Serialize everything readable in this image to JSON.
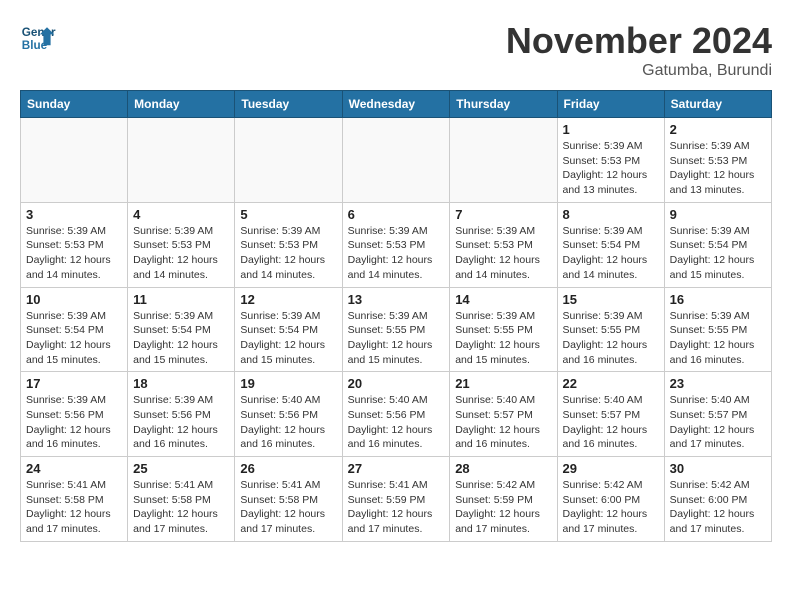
{
  "header": {
    "logo_line1": "General",
    "logo_line2": "Blue",
    "month": "November 2024",
    "location": "Gatumba, Burundi"
  },
  "weekdays": [
    "Sunday",
    "Monday",
    "Tuesday",
    "Wednesday",
    "Thursday",
    "Friday",
    "Saturday"
  ],
  "weeks": [
    [
      {
        "day": "",
        "info": ""
      },
      {
        "day": "",
        "info": ""
      },
      {
        "day": "",
        "info": ""
      },
      {
        "day": "",
        "info": ""
      },
      {
        "day": "",
        "info": ""
      },
      {
        "day": "1",
        "info": "Sunrise: 5:39 AM\nSunset: 5:53 PM\nDaylight: 12 hours\nand 13 minutes."
      },
      {
        "day": "2",
        "info": "Sunrise: 5:39 AM\nSunset: 5:53 PM\nDaylight: 12 hours\nand 13 minutes."
      }
    ],
    [
      {
        "day": "3",
        "info": "Sunrise: 5:39 AM\nSunset: 5:53 PM\nDaylight: 12 hours\nand 14 minutes."
      },
      {
        "day": "4",
        "info": "Sunrise: 5:39 AM\nSunset: 5:53 PM\nDaylight: 12 hours\nand 14 minutes."
      },
      {
        "day": "5",
        "info": "Sunrise: 5:39 AM\nSunset: 5:53 PM\nDaylight: 12 hours\nand 14 minutes."
      },
      {
        "day": "6",
        "info": "Sunrise: 5:39 AM\nSunset: 5:53 PM\nDaylight: 12 hours\nand 14 minutes."
      },
      {
        "day": "7",
        "info": "Sunrise: 5:39 AM\nSunset: 5:53 PM\nDaylight: 12 hours\nand 14 minutes."
      },
      {
        "day": "8",
        "info": "Sunrise: 5:39 AM\nSunset: 5:54 PM\nDaylight: 12 hours\nand 14 minutes."
      },
      {
        "day": "9",
        "info": "Sunrise: 5:39 AM\nSunset: 5:54 PM\nDaylight: 12 hours\nand 15 minutes."
      }
    ],
    [
      {
        "day": "10",
        "info": "Sunrise: 5:39 AM\nSunset: 5:54 PM\nDaylight: 12 hours\nand 15 minutes."
      },
      {
        "day": "11",
        "info": "Sunrise: 5:39 AM\nSunset: 5:54 PM\nDaylight: 12 hours\nand 15 minutes."
      },
      {
        "day": "12",
        "info": "Sunrise: 5:39 AM\nSunset: 5:54 PM\nDaylight: 12 hours\nand 15 minutes."
      },
      {
        "day": "13",
        "info": "Sunrise: 5:39 AM\nSunset: 5:55 PM\nDaylight: 12 hours\nand 15 minutes."
      },
      {
        "day": "14",
        "info": "Sunrise: 5:39 AM\nSunset: 5:55 PM\nDaylight: 12 hours\nand 15 minutes."
      },
      {
        "day": "15",
        "info": "Sunrise: 5:39 AM\nSunset: 5:55 PM\nDaylight: 12 hours\nand 16 minutes."
      },
      {
        "day": "16",
        "info": "Sunrise: 5:39 AM\nSunset: 5:55 PM\nDaylight: 12 hours\nand 16 minutes."
      }
    ],
    [
      {
        "day": "17",
        "info": "Sunrise: 5:39 AM\nSunset: 5:56 PM\nDaylight: 12 hours\nand 16 minutes."
      },
      {
        "day": "18",
        "info": "Sunrise: 5:39 AM\nSunset: 5:56 PM\nDaylight: 12 hours\nand 16 minutes."
      },
      {
        "day": "19",
        "info": "Sunrise: 5:40 AM\nSunset: 5:56 PM\nDaylight: 12 hours\nand 16 minutes."
      },
      {
        "day": "20",
        "info": "Sunrise: 5:40 AM\nSunset: 5:56 PM\nDaylight: 12 hours\nand 16 minutes."
      },
      {
        "day": "21",
        "info": "Sunrise: 5:40 AM\nSunset: 5:57 PM\nDaylight: 12 hours\nand 16 minutes."
      },
      {
        "day": "22",
        "info": "Sunrise: 5:40 AM\nSunset: 5:57 PM\nDaylight: 12 hours\nand 16 minutes."
      },
      {
        "day": "23",
        "info": "Sunrise: 5:40 AM\nSunset: 5:57 PM\nDaylight: 12 hours\nand 17 minutes."
      }
    ],
    [
      {
        "day": "24",
        "info": "Sunrise: 5:41 AM\nSunset: 5:58 PM\nDaylight: 12 hours\nand 17 minutes."
      },
      {
        "day": "25",
        "info": "Sunrise: 5:41 AM\nSunset: 5:58 PM\nDaylight: 12 hours\nand 17 minutes."
      },
      {
        "day": "26",
        "info": "Sunrise: 5:41 AM\nSunset: 5:58 PM\nDaylight: 12 hours\nand 17 minutes."
      },
      {
        "day": "27",
        "info": "Sunrise: 5:41 AM\nSunset: 5:59 PM\nDaylight: 12 hours\nand 17 minutes."
      },
      {
        "day": "28",
        "info": "Sunrise: 5:42 AM\nSunset: 5:59 PM\nDaylight: 12 hours\nand 17 minutes."
      },
      {
        "day": "29",
        "info": "Sunrise: 5:42 AM\nSunset: 6:00 PM\nDaylight: 12 hours\nand 17 minutes."
      },
      {
        "day": "30",
        "info": "Sunrise: 5:42 AM\nSunset: 6:00 PM\nDaylight: 12 hours\nand 17 minutes."
      }
    ]
  ]
}
